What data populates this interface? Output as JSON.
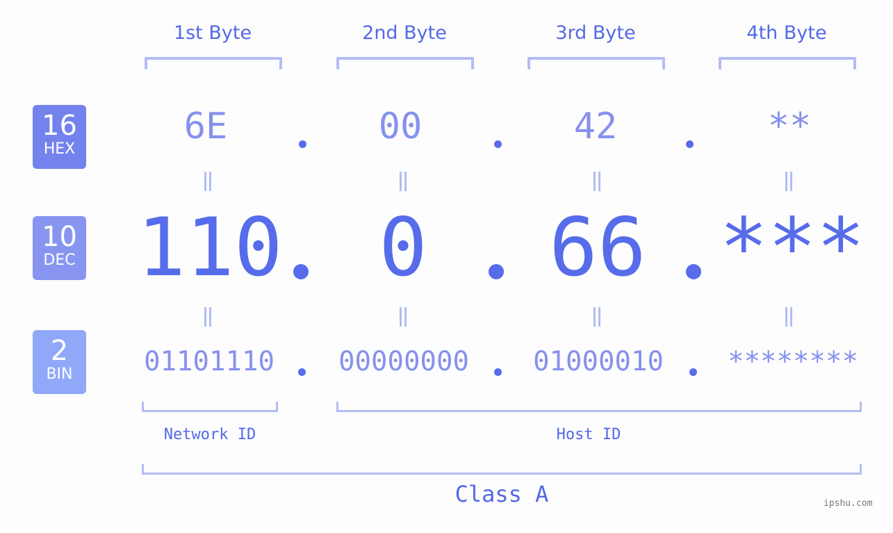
{
  "byte_headers": [
    "1st Byte",
    "2nd Byte",
    "3rd Byte",
    "4th Byte"
  ],
  "rows": {
    "hex": {
      "base": "16",
      "label": "HEX",
      "values": [
        "6E",
        "00",
        "42",
        "**"
      ],
      "color": "#7382ec"
    },
    "dec": {
      "base": "10",
      "label": "DEC",
      "values": [
        "110",
        "0",
        "66",
        "***"
      ],
      "color": "#8795f1"
    },
    "bin": {
      "base": "2",
      "label": "BIN",
      "values": [
        "01101110",
        "00000000",
        "01000010",
        "********"
      ],
      "color": "#8fa8f8"
    }
  },
  "segments": {
    "network_id": "Network ID",
    "host_id": "Host ID"
  },
  "class_label": "Class A",
  "watermark": "ipshu.com",
  "colors": {
    "accent": "#566cea",
    "muted": "#8691ee",
    "bracket": "#b3bcf6",
    "background": "#fcfdfc"
  }
}
